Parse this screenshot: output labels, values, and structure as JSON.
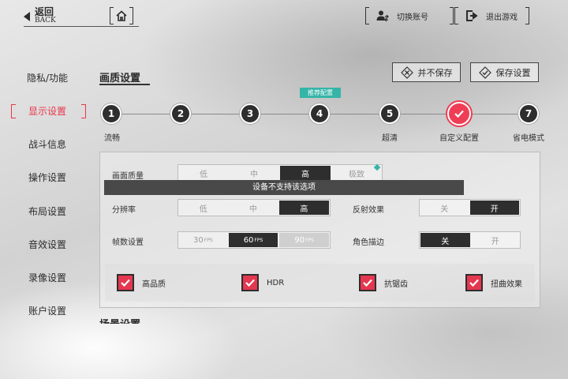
{
  "topbar": {
    "back_cn": "返回",
    "back_en": "BACK",
    "switch_account": "切换账号",
    "exit_game": "退出游戏"
  },
  "sidebar": {
    "items": [
      {
        "label": "隐私/功能",
        "active": false
      },
      {
        "label": "显示设置",
        "active": true
      },
      {
        "label": "战斗信息",
        "active": false
      },
      {
        "label": "操作设置",
        "active": false
      },
      {
        "label": "布局设置",
        "active": false
      },
      {
        "label": "音效设置",
        "active": false
      },
      {
        "label": "录像设置",
        "active": false
      },
      {
        "label": "账户设置",
        "active": false
      }
    ]
  },
  "header": {
    "title": "画质设置",
    "discard_label": "并不保存",
    "save_label": "保存设置"
  },
  "presets": {
    "recommended_badge": "推荐配置",
    "items": [
      {
        "number": "1",
        "label": "流畅"
      },
      {
        "number": "2",
        "label": ""
      },
      {
        "number": "3",
        "label": ""
      },
      {
        "number": "4",
        "label": ""
      },
      {
        "number": "5",
        "label": "超清"
      },
      {
        "number": "",
        "label": "自定义配置",
        "selected": true
      },
      {
        "number": "7",
        "label": "省电模式"
      }
    ]
  },
  "settings": {
    "quality": {
      "label": "画面质量",
      "options": [
        "低",
        "中",
        "高",
        "极致"
      ],
      "selected": "高"
    },
    "toast": "设备不支持该选项",
    "resolution": {
      "label": "分辨率",
      "options": [
        "低",
        "中",
        "高"
      ],
      "selected": "高"
    },
    "reflection": {
      "label": "反射效果",
      "options": [
        "关",
        "开"
      ],
      "selected": "开"
    },
    "fps": {
      "label": "帧数设置",
      "options": [
        "30",
        "60",
        "90"
      ],
      "unit": "FPS",
      "selected": "60",
      "disabled": "90"
    },
    "outline": {
      "label": "角色描边",
      "options": [
        "关",
        "开"
      ],
      "selected": "关"
    },
    "checkboxes": [
      {
        "label": "高品质",
        "checked": true
      },
      {
        "label": "HDR",
        "checked": true
      },
      {
        "label": "抗锯齿",
        "checked": true
      },
      {
        "label": "扭曲效果",
        "checked": true
      }
    ]
  },
  "next_section": "场景设置",
  "colors": {
    "accent": "#ef3d55",
    "badge": "#35b5a8",
    "dark": "#2e2e2e"
  }
}
